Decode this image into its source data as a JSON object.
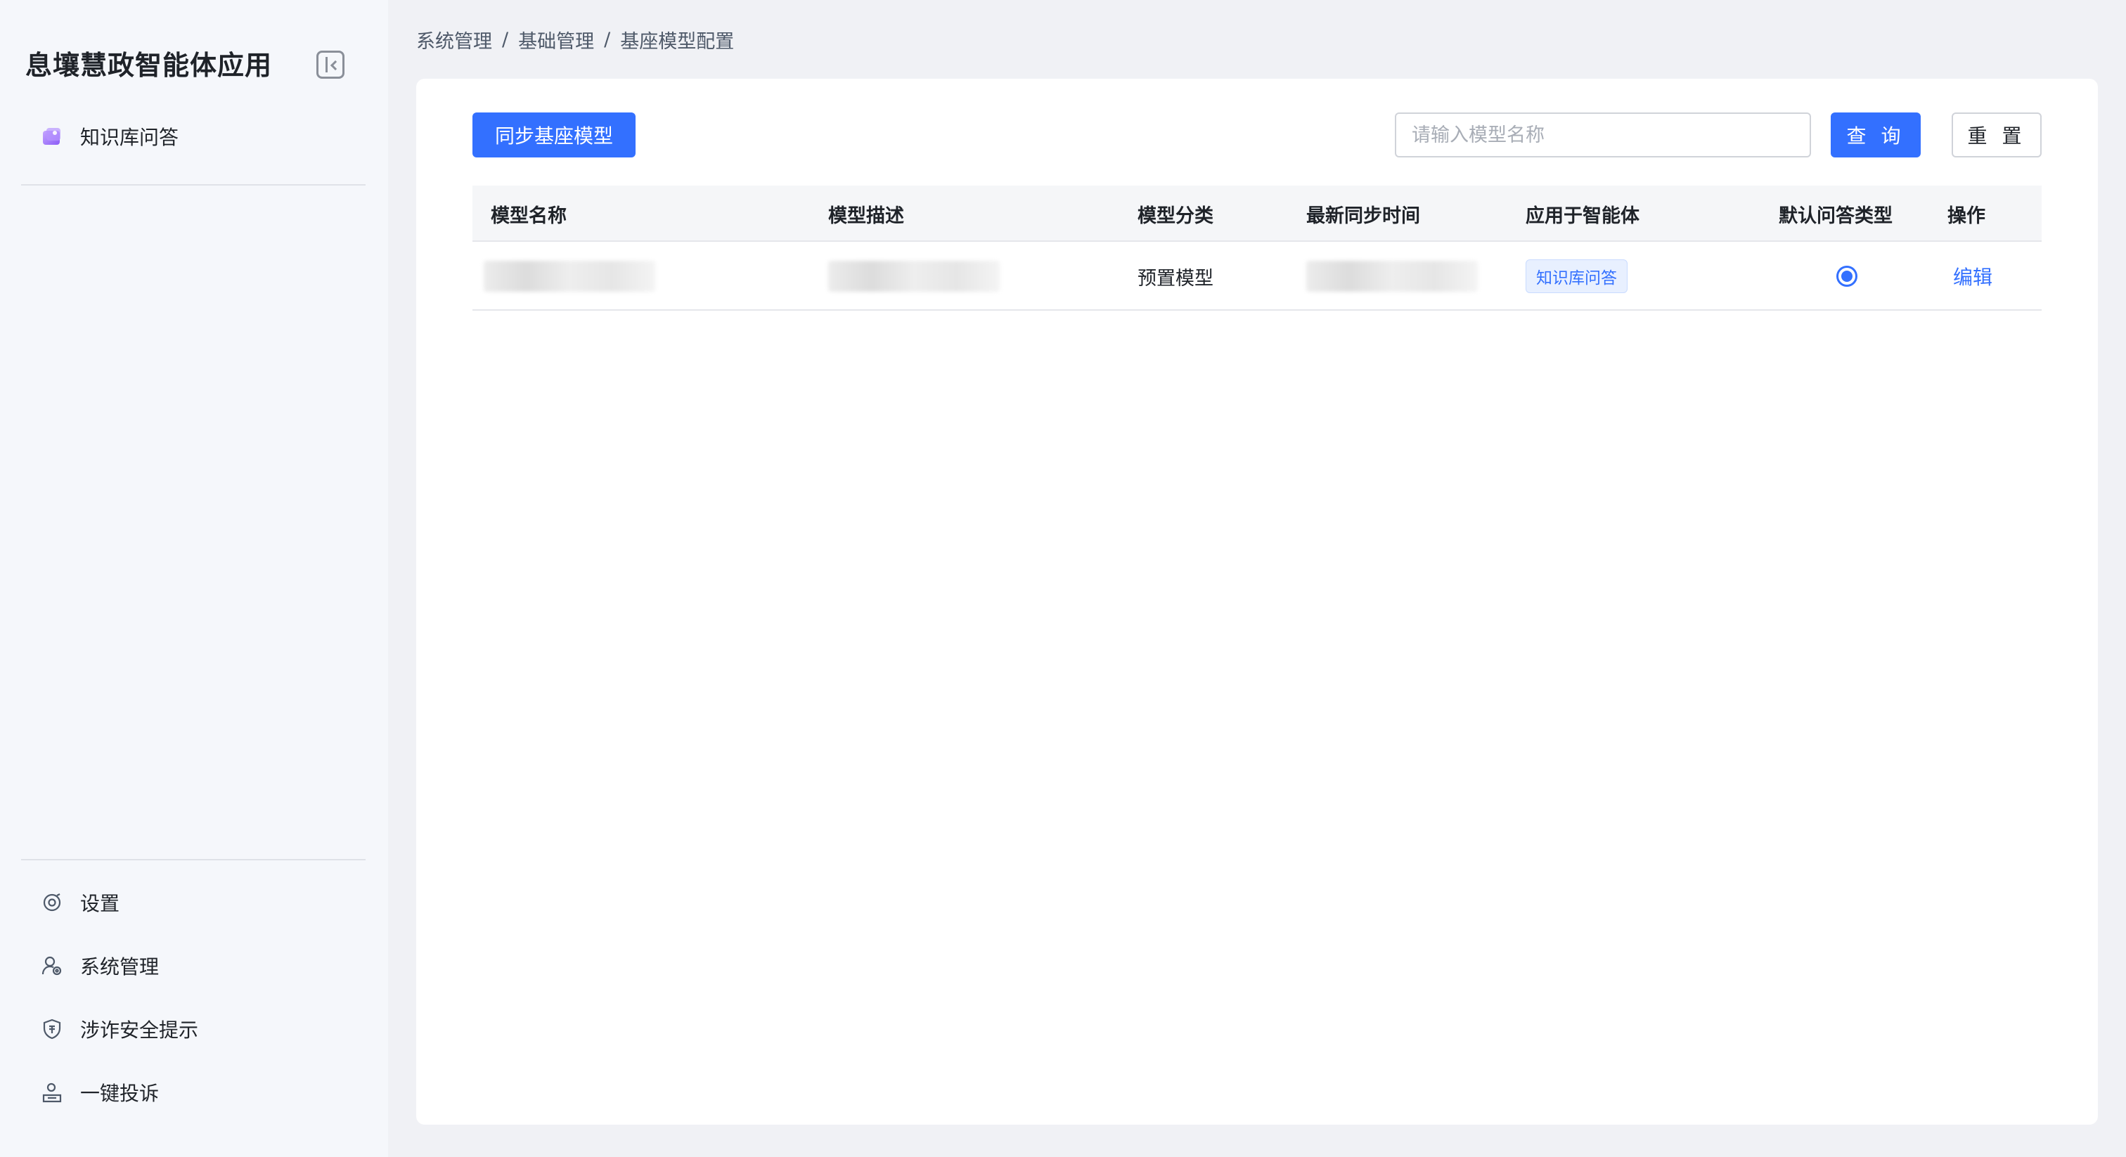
{
  "app": {
    "title": "息壤慧政智能体应用"
  },
  "sidebar": {
    "top_items": [
      {
        "label": "知识库问答",
        "icon": "knowledge-base-icon"
      }
    ],
    "bottom_items": [
      {
        "label": "设置",
        "icon": "settings-icon"
      },
      {
        "label": "系统管理",
        "icon": "user-settings-icon"
      },
      {
        "label": "涉诈安全提示",
        "icon": "shield-alert-icon"
      },
      {
        "label": "一键投诉",
        "icon": "complaint-icon"
      }
    ]
  },
  "breadcrumb": {
    "items": [
      "系统管理",
      "基础管理",
      "基座模型配置"
    ],
    "separator": "/"
  },
  "toolbar": {
    "sync_label": "同步基座模型",
    "search_placeholder": "请输入模型名称",
    "search_value": "",
    "query_label": "查 询",
    "reset_label": "重 置"
  },
  "table": {
    "columns": [
      "模型名称",
      "模型描述",
      "模型分类",
      "最新同步时间",
      "应用于智能体",
      "默认问答类型",
      "操作"
    ],
    "rows": [
      {
        "category": "预置模型",
        "agent_tag": "知识库问答",
        "default_selected": true,
        "action": "编辑"
      }
    ]
  },
  "colors": {
    "primary": "#3370ff",
    "sidebar_bg": "#f5f7fb",
    "page_bg": "#f0f1f5",
    "tag_bg": "#e8f0ff"
  }
}
